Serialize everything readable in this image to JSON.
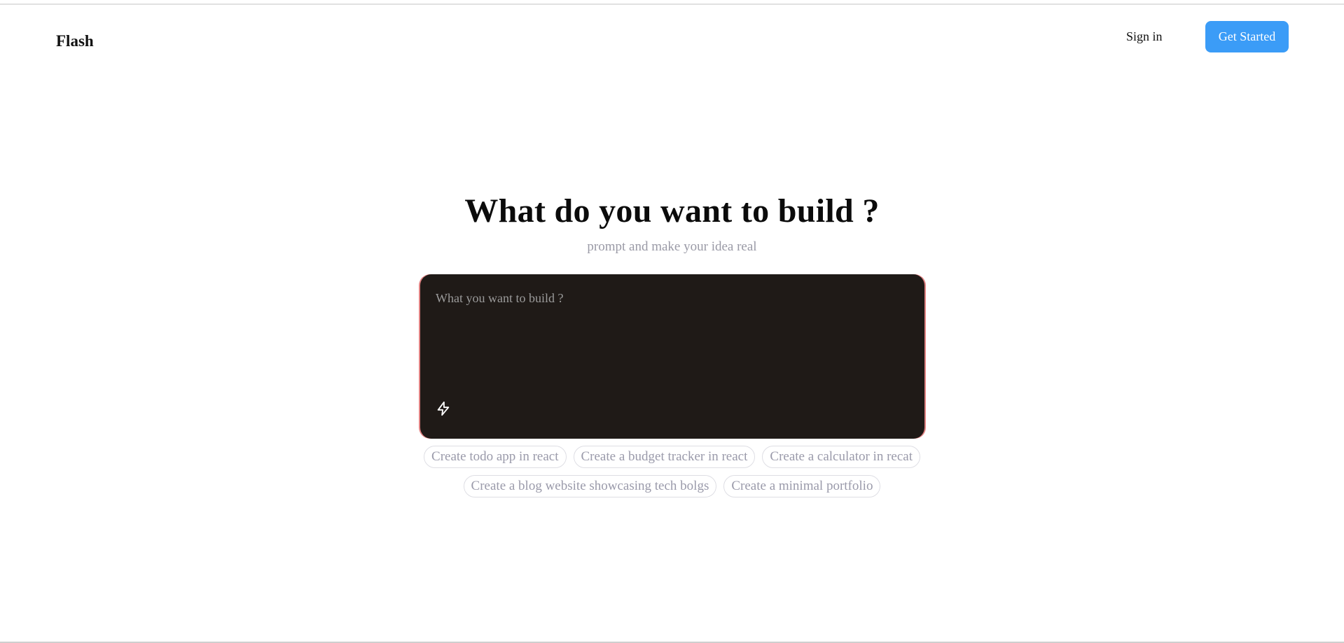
{
  "header": {
    "logo": "Flash",
    "signin_label": "Sign in",
    "get_started_label": "Get Started"
  },
  "hero": {
    "title": "What do you want to build ?",
    "subtitle": "prompt and make your idea real"
  },
  "prompt": {
    "placeholder": "What you want to build ?",
    "value": "",
    "submit_icon": "lightning-bolt-icon"
  },
  "suggestions": {
    "row1": [
      "Create todo app in react",
      "Create a budget tracker in react",
      "Create a calculator in recat"
    ],
    "row2": [
      "Create a blog website showcasing tech bolgs",
      "Create a minimal portfolio"
    ]
  },
  "colors": {
    "accent": "#3b9cf7",
    "prompt_bg": "#1f1a17",
    "muted_text": "#9a9aa6"
  }
}
